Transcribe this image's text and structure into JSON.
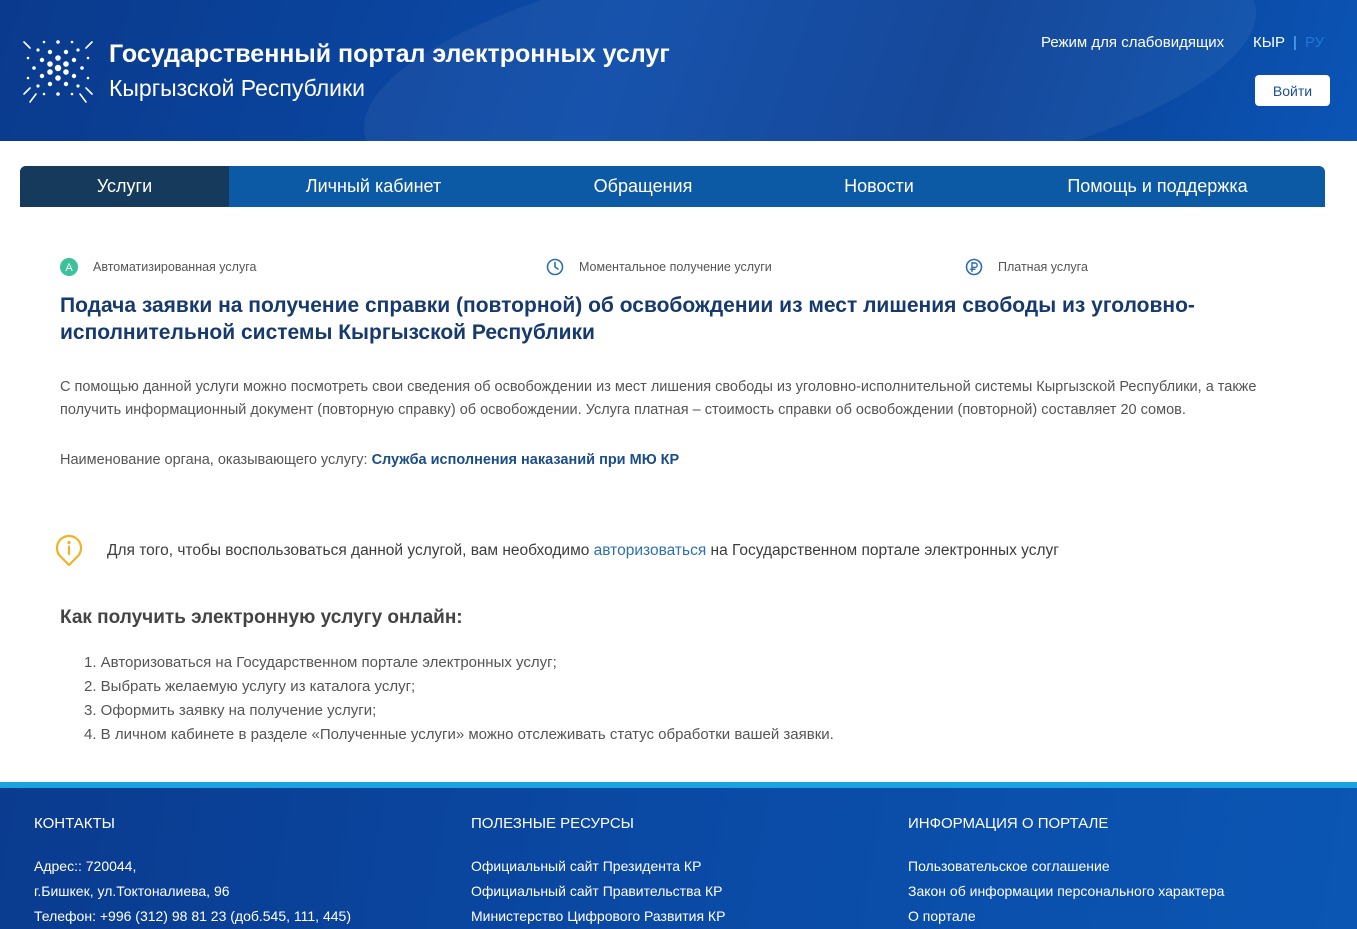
{
  "header": {
    "title_line1": "Государственный портал электронных услуг",
    "title_line2": "Кыргызской Республики",
    "low_vision": "Режим для слабовидящих",
    "lang_kg": "КЫР",
    "lang_sep": "|",
    "lang_ru": "РУ",
    "login": "Войти"
  },
  "nav": {
    "tabs": [
      {
        "label": "Услуги"
      },
      {
        "label": "Личный кабинет"
      },
      {
        "label": "Обращения"
      },
      {
        "label": "Новости"
      },
      {
        "label": "Помощь и поддержка"
      }
    ]
  },
  "badges": {
    "automated": "Автоматизированная услуга",
    "automated_letter": "A",
    "instant": "Моментальное получение услуги",
    "paid": "Платная услуга"
  },
  "service": {
    "title": "Подача заявки на получение справки (повторной) об освобождении из мест лишения свободы из уголовно-исполнительной системы Кыргызской Республики",
    "description": "С помощью данной услуги можно посмотреть свои сведения об освобождении из мест лишения свободы из уголовно-исполнительной системы Кыргызской Республики, а также получить информационный документ (повторную справку) об освобождении. Услуга платная – стоимость справки об освобождении (повторной) составляет 20 сомов.",
    "org_label": "Наименование органа, оказывающего услугу:",
    "org_name": "Служба исполнения наказаний при МЮ КР"
  },
  "info": {
    "before": "Для того, чтобы воспользоваться данной услугой, вам необходимо",
    "link": "авторизоваться",
    "after": "на Государственном портале электронных услуг"
  },
  "howto": {
    "title": "Как получить электронную услугу онлайн:",
    "steps": [
      "1. Авторизоваться на Государственном портале электронных услуг;",
      "2. Выбрать желаемую услугу из каталога услуг;",
      "3. Оформить заявку на получение услуги;",
      "4. В личном кабинете в разделе «Полученные услуги» можно отслеживать статус обработки вашей заявки."
    ]
  },
  "footer": {
    "contacts": {
      "title": "КОНТАКТЫ",
      "items": [
        "Адрес:: 720044,",
        "г.Бишкек, ул.Токтоналиева, 96",
        "Телефон: +996 (312) 98 81 23 (доб.545, 111, 445)"
      ]
    },
    "resources": {
      "title": "ПОЛЕЗНЫЕ РЕСУРСЫ",
      "items": [
        "Официальный сайт Президента КР",
        "Официальный сайт Правительства КР",
        "Министерство Цифрового Развития КР"
      ]
    },
    "about": {
      "title": "ИНФОРМАЦИЯ О ПОРТАЛЕ",
      "items": [
        "Пользовательское соглашение",
        "Закон об информации персонального характера",
        "О портале"
      ]
    }
  },
  "colors": {
    "header_bg": "#0b4aa8",
    "nav_bg": "#0c5aa6",
    "nav_active": "#163a5c",
    "title": "#163a6e",
    "accent_green": "#3cc29a",
    "accent_blue": "#2f6cb0",
    "info_yellow": "#f0b323",
    "footer_line": "#1aa3e0"
  }
}
